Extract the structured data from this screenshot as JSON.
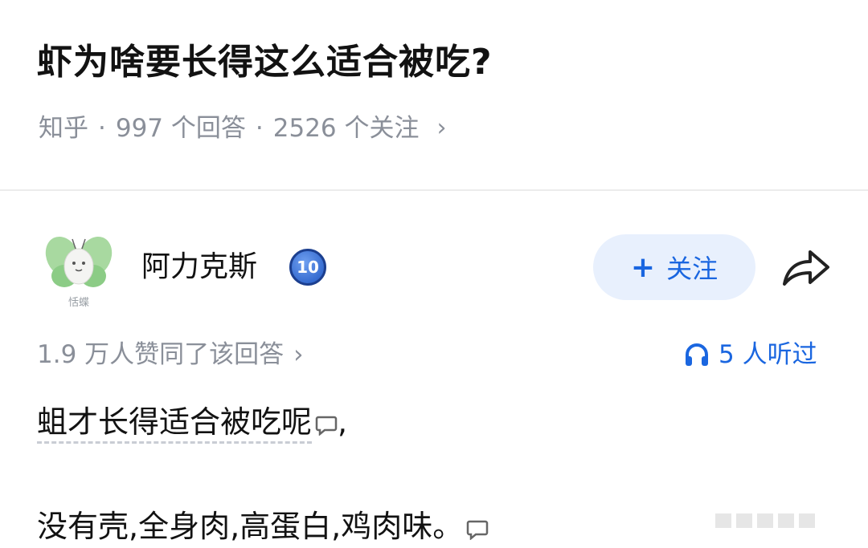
{
  "question": {
    "title": "虾为啥要长得这么适合被吃?",
    "source": "知乎",
    "separator": "·",
    "answers": "997 个回答",
    "followers": "2526 个关注",
    "chevron": "›"
  },
  "author": {
    "name": "阿力克斯",
    "avatar_caption": "恬蝶",
    "level": "10",
    "follow_plus": "+",
    "follow_label": "关注",
    "share_icon": "share-arrow-icon"
  },
  "stats": {
    "votes": "1.9 万人赞同了该回答",
    "chevron": "›",
    "listened": "5 人听过",
    "listen_icon": "headphones-icon"
  },
  "answer": {
    "line1_underlined": "蛆才长得适合被吃呢",
    "line1_tail": ",",
    "line2": "没有壳,全身肉,高蛋白,鸡肉味。"
  },
  "colors": {
    "accent": "#1a66e0",
    "follow_bg": "#e8f0fd",
    "muted": "#8a8f99",
    "text": "#121212"
  }
}
